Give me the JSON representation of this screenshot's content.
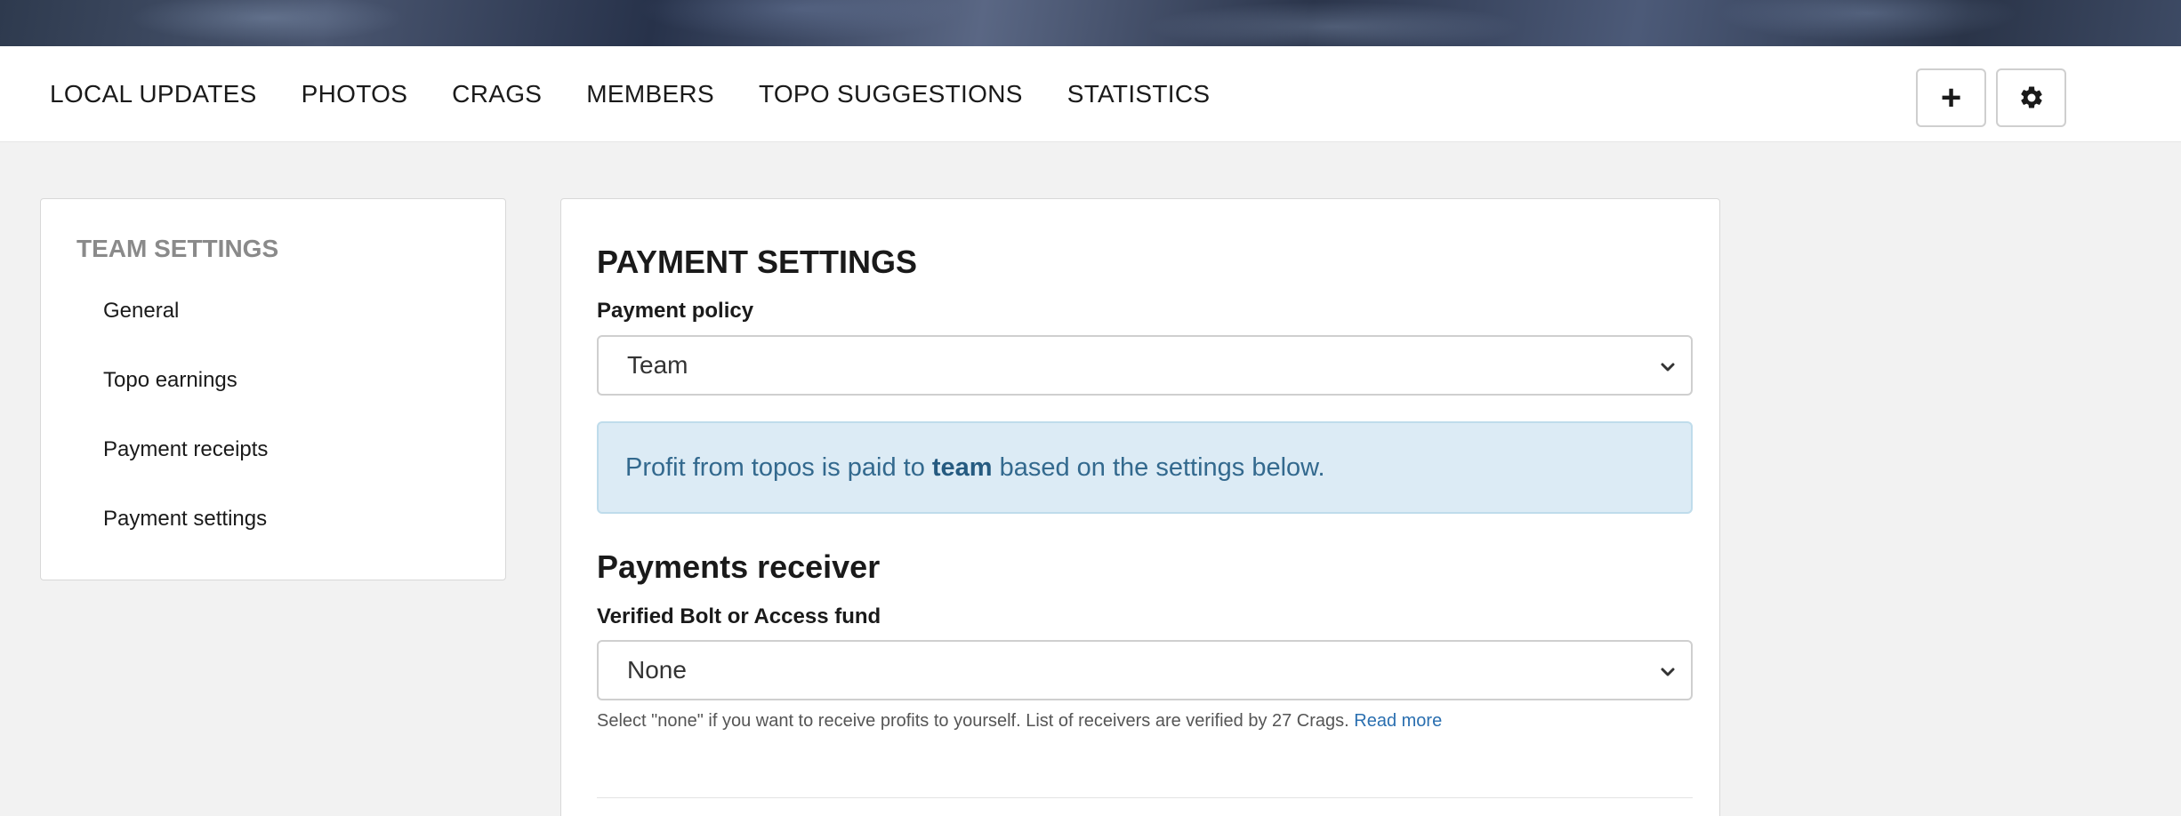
{
  "nav": {
    "links": [
      "LOCAL UPDATES",
      "PHOTOS",
      "CRAGS",
      "MEMBERS",
      "TOPO SUGGESTIONS",
      "STATISTICS"
    ],
    "add_icon": "plus-icon",
    "settings_icon": "gear-icon"
  },
  "sidebar": {
    "title": "TEAM SETTINGS",
    "items": [
      "General",
      "Topo earnings",
      "Payment receipts",
      "Payment settings"
    ]
  },
  "main": {
    "title": "PAYMENT SETTINGS",
    "policy_label": "Payment policy",
    "policy_value": "Team",
    "info_prefix": "Profit from topos is paid to",
    "info_bold": "team",
    "info_suffix": "based on the settings below.",
    "receiver_heading": "Payments receiver",
    "fund_label": "Verified Bolt or Access fund",
    "fund_value": "None",
    "help_text": "Select \"none\" if you want to receive profits to yourself. List of receivers are verified by 27 Crags.",
    "help_link": "Read more"
  },
  "colors": {
    "info_bg": "#dcebf5",
    "info_text": "#33698e",
    "link": "#2a6fb0"
  }
}
